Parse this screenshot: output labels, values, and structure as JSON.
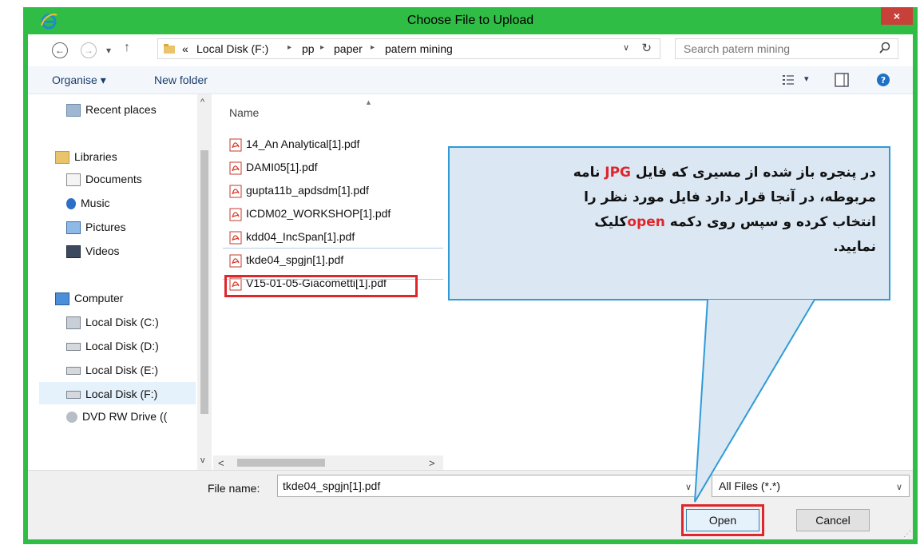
{
  "window": {
    "title": "Choose File to Upload",
    "close_glyph": "×"
  },
  "address_bar": {
    "overflow": "«",
    "crumbs": [
      "Local Disk (F:)",
      "pp",
      "paper",
      "patern mining"
    ],
    "sep": "▸",
    "dropdown": "∨",
    "refresh": "↻"
  },
  "search": {
    "placeholder": "Search patern mining"
  },
  "nav_buttons": {
    "back": "←",
    "forward": "→",
    "recent": "▾",
    "up": "↑"
  },
  "toolbar": {
    "organise": "Organise ▾",
    "new_folder": "New folder",
    "view_dd": "▾"
  },
  "navigation": {
    "recent_places": "Recent places",
    "libraries": "Libraries",
    "documents": "Documents",
    "music": "Music",
    "pictures": "Pictures",
    "videos": "Videos",
    "computer": "Computer",
    "disk_c": "Local Disk (C:)",
    "disk_d": "Local Disk (D:)",
    "disk_e": "Local Disk (E:)",
    "disk_f": "Local Disk (F:)",
    "dvd": "DVD RW Drive (("
  },
  "file_list": {
    "column_name": "Name",
    "files": [
      "14_An Analytical[1].pdf",
      "DAMI05[1].pdf",
      "gupta11b_apdsdm[1].pdf",
      "ICDM02_WORKSHOP[1].pdf",
      "kdd04_IncSpan[1].pdf",
      "tkde04_spgjn[1].pdf",
      "V15-01-05-Giacometti[1].pdf"
    ],
    "selected_index": 5
  },
  "bottom": {
    "file_name_label": "File name:",
    "file_name_value": "tkde04_spgjn[1].pdf",
    "file_type_value": "All Files (*.*)",
    "open_label": "Open",
    "cancel_label": "Cancel"
  },
  "callout": {
    "line1_a": "در پنجره باز شده از مسیری که فایل ",
    "line1_hl": "JPG",
    "line1_b": " نامه",
    "line2": "مربوطه، در آنجا قرار دارد  فایل مورد نظر را",
    "line3_a": "انتخاب کرده و سپس روی دکمه ",
    "line3_hl": "open",
    "line3_b": "کلیک",
    "line4": "نمایید."
  },
  "colors": {
    "window_frame": "#2fbd45",
    "highlight_red": "#e0252b",
    "callout_border": "#2f9bd6",
    "callout_fill": "#dbe8f4"
  }
}
